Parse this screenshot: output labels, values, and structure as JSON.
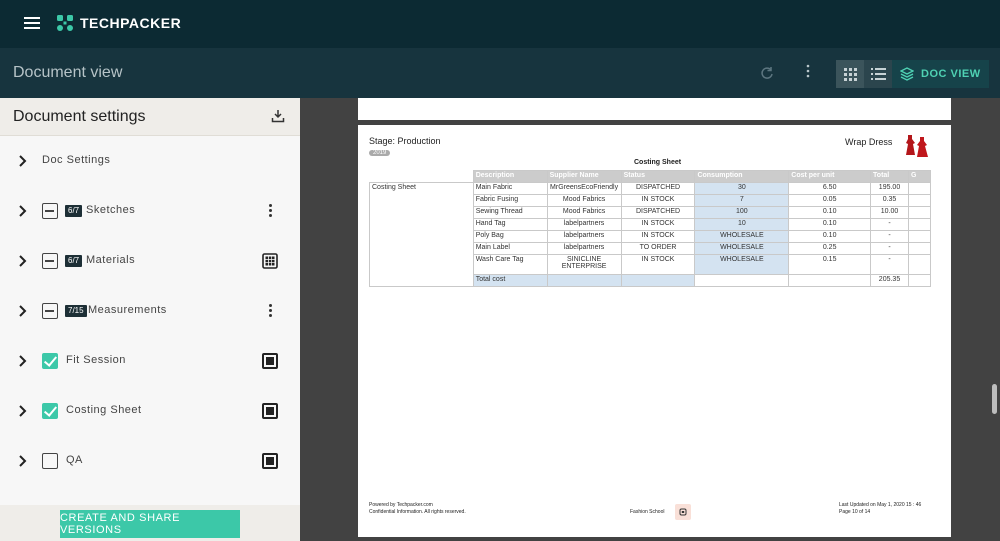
{
  "topbar": {
    "brand": "TECHPACKER"
  },
  "subbar": {
    "title": "Document view",
    "doc_view_label": "DOC VIEW"
  },
  "sidebar": {
    "title": "Document settings",
    "share_label": "CREATE AND SHARE VERSIONS",
    "items": [
      {
        "label": "Doc Settings",
        "count": "",
        "check": "none",
        "action": "none"
      },
      {
        "label": "Sketches",
        "count": "6/7",
        "check": "minus",
        "action": "kebab"
      },
      {
        "label": "Materials",
        "count": "6/7",
        "check": "minus",
        "action": "grid"
      },
      {
        "label": "Measurements",
        "count": "7/15",
        "check": "minus",
        "action": "kebab"
      },
      {
        "label": "Fit Session",
        "count": "",
        "check": "checked",
        "action": "square"
      },
      {
        "label": "Costing Sheet",
        "count": "",
        "check": "checked",
        "action": "square"
      },
      {
        "label": "QA",
        "count": "",
        "check": "empty",
        "action": "square"
      }
    ]
  },
  "document": {
    "stage": "Stage: Production",
    "year_tag": "2019",
    "product_name": "Wrap Dress",
    "sheet_title": "Costing Sheet",
    "row_label": "Costing Sheet",
    "columns": [
      "Description",
      "Supplier Name",
      "Status",
      "Consumption",
      "Cost per unit",
      "Total",
      "G"
    ],
    "rows": [
      [
        "Main Fabric",
        "MrGreensEcoFriendly",
        "DISPATCHED",
        "30",
        "6.50",
        "195.00"
      ],
      [
        "Fabric Fusing",
        "Mood Fabrics",
        "IN STOCK",
        "7",
        "0.05",
        "0.35"
      ],
      [
        "Sewing Thread",
        "Mood Fabrics",
        "DISPATCHED",
        "100",
        "0.10",
        "10.00"
      ],
      [
        "Hand Tag",
        "labelpartners",
        "IN STOCK",
        "10",
        "0.10",
        "-"
      ],
      [
        "Poly Bag",
        "labelpartners",
        "IN STOCK",
        "WHOLESALE",
        "0.10",
        "-"
      ],
      [
        "Main Label",
        "labelpartners",
        "TO ORDER",
        "WHOLESALE",
        "0.25",
        "-"
      ],
      [
        "Wash Care Tag",
        "SINICLINE ENTERPRISE",
        "IN STOCK",
        "WHOLESALE",
        "0.15",
        "-"
      ]
    ],
    "total_label": "Total cost",
    "total_value": "205.35",
    "footer_powered": "Powered by Techpacker.com",
    "footer_confidential": "Confidential Information. All rights reserved.",
    "footer_school": "Fashion School",
    "footer_updated": "Last Updated on May 1, 2020 15 : 46",
    "footer_page": "Page 10 of 14"
  },
  "colors": {
    "accent": "#3cc8a8",
    "topbar": "#0c2a33",
    "subbar": "#17343e"
  }
}
